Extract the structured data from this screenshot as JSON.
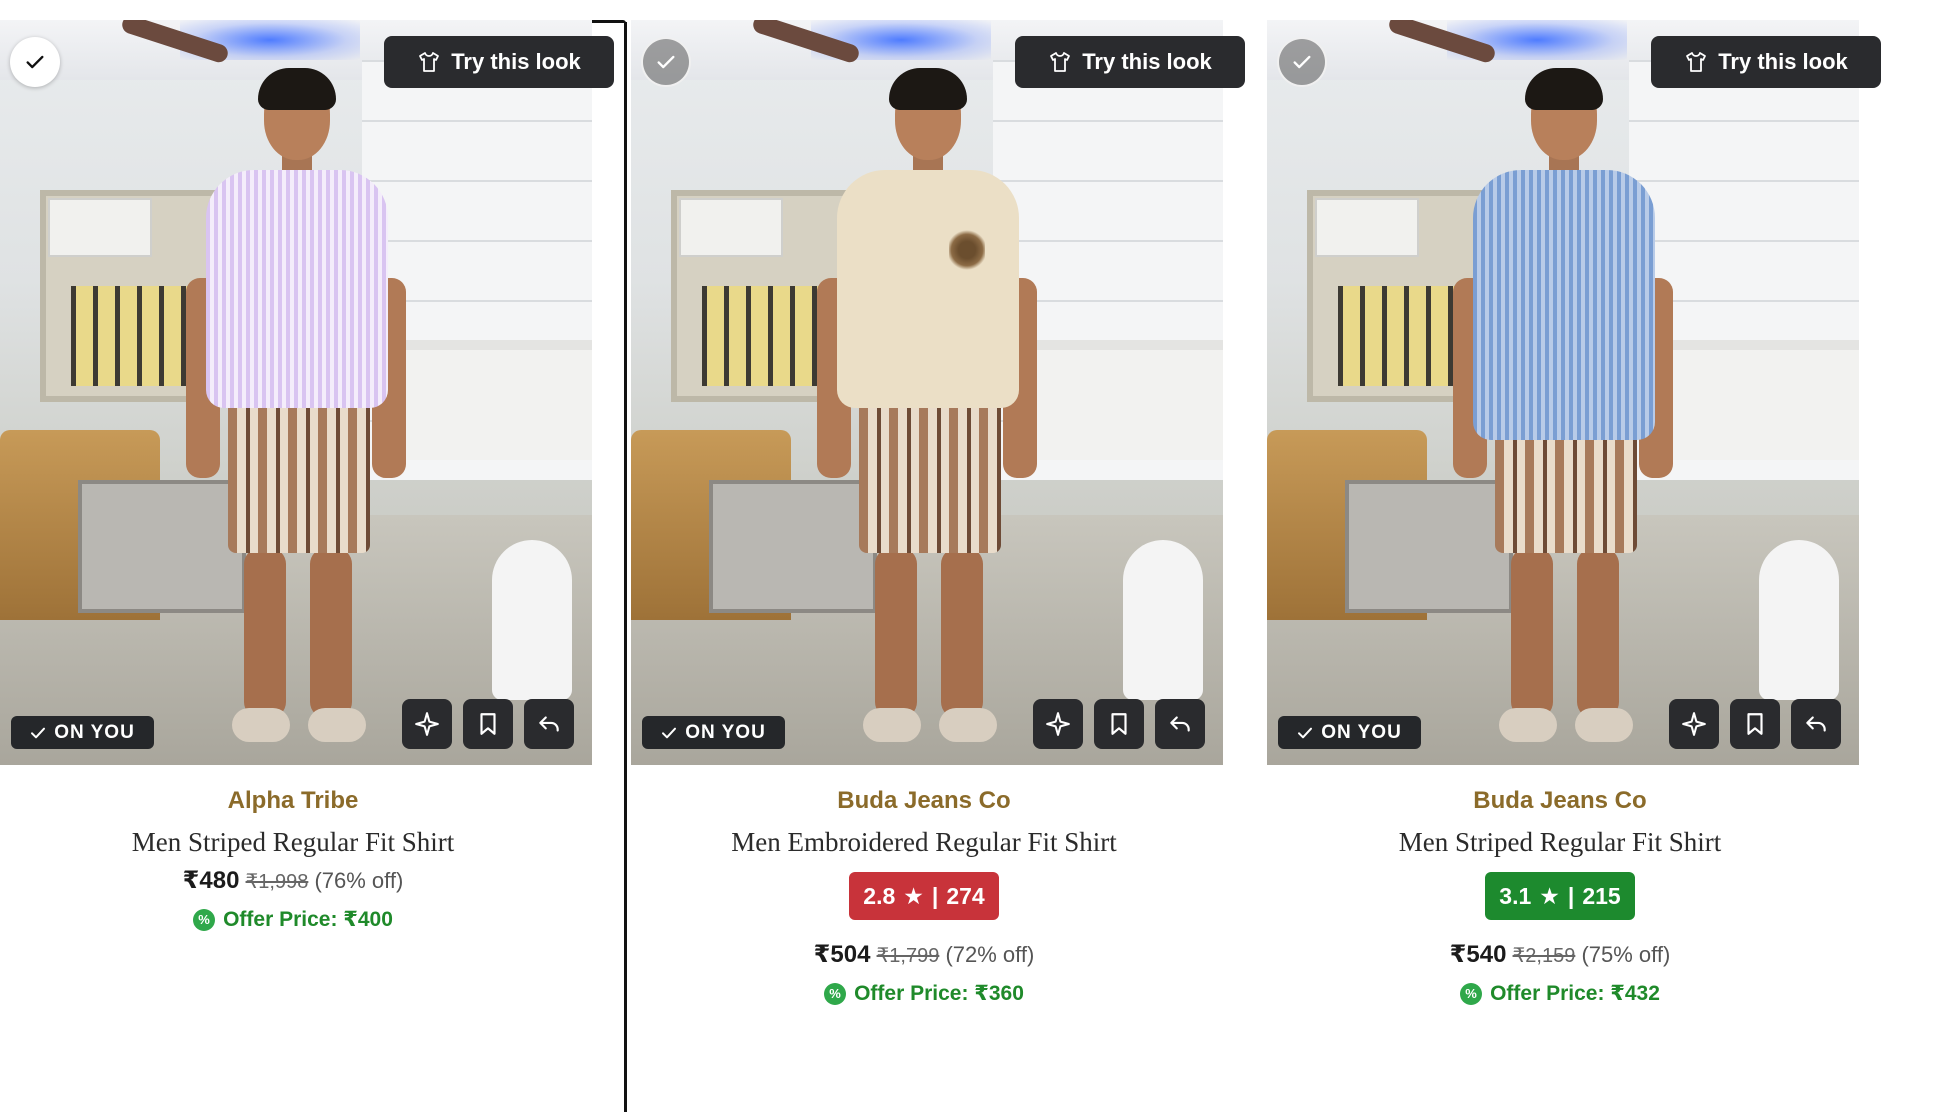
{
  "actions": {
    "try_label": "Try this look",
    "on_you_label": "ON YOU"
  },
  "icons": {
    "select": "check-icon",
    "try": "tshirt-icon",
    "sparkle": "sparkle-icon",
    "save": "bookmark-icon",
    "undo": "undo-icon",
    "offer": "percent-badge-icon"
  },
  "colors": {
    "brand_text": "#8b6b2a",
    "offer_text": "#1f8a2a",
    "rating_low": "#c8333a",
    "rating_mid": "#1d8a2e",
    "dark_button": "#2a2b2e"
  },
  "products": [
    {
      "selected": true,
      "brand": "Alpha Tribe",
      "title": "Men Striped Regular Fit Shirt",
      "price": "₹480",
      "mrp": "₹1,998",
      "discount": "(76% off)",
      "offer": "Offer Price: ₹400",
      "shirt_color": "lavender stripes"
    },
    {
      "selected": false,
      "brand": "Buda Jeans Co",
      "title": "Men Embroidered Regular Fit Shirt",
      "rating": "2.8",
      "rating_count": "274",
      "price": "₹504",
      "mrp": "₹1,799",
      "discount": "(72% off)",
      "offer": "Offer Price: ₹360",
      "shirt_color": "cream"
    },
    {
      "selected": false,
      "brand": "Buda Jeans Co",
      "title": "Men Striped Regular Fit Shirt",
      "rating": "3.1",
      "rating_count": "215",
      "price": "₹540",
      "mrp": "₹2,159",
      "discount": "(75% off)",
      "offer": "Offer Price: ₹432",
      "shirt_color": "blue stripes"
    }
  ],
  "rating_separator": "|",
  "offer_pct_symbol": "%"
}
